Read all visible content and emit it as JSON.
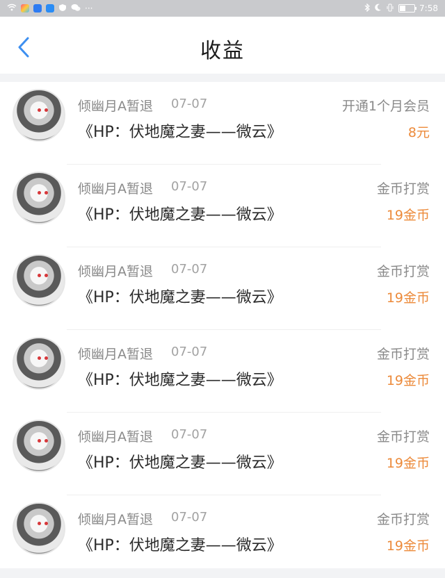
{
  "status_bar": {
    "time": "7:58",
    "more": "···"
  },
  "header": {
    "title": "收益"
  },
  "colors": {
    "accent_blue": "#3d8ff0",
    "amount_orange": "#ec8a3a"
  },
  "items": [
    {
      "name": "倾幽月A暂退",
      "date": "07-07",
      "type": "开通1个月会员",
      "book": "《HP：伏地魔之妻——微云》",
      "amount": "8元"
    },
    {
      "name": "倾幽月A暂退",
      "date": "07-07",
      "type": "金币打赏",
      "book": "《HP：伏地魔之妻——微云》",
      "amount": "19金币"
    },
    {
      "name": "倾幽月A暂退",
      "date": "07-07",
      "type": "金币打赏",
      "book": "《HP：伏地魔之妻——微云》",
      "amount": "19金币"
    },
    {
      "name": "倾幽月A暂退",
      "date": "07-07",
      "type": "金币打赏",
      "book": "《HP：伏地魔之妻——微云》",
      "amount": "19金币"
    },
    {
      "name": "倾幽月A暂退",
      "date": "07-07",
      "type": "金币打赏",
      "book": "《HP：伏地魔之妻——微云》",
      "amount": "19金币"
    },
    {
      "name": "倾幽月A暂退",
      "date": "07-07",
      "type": "金币打赏",
      "book": "《HP：伏地魔之妻——微云》",
      "amount": "19金币"
    }
  ]
}
